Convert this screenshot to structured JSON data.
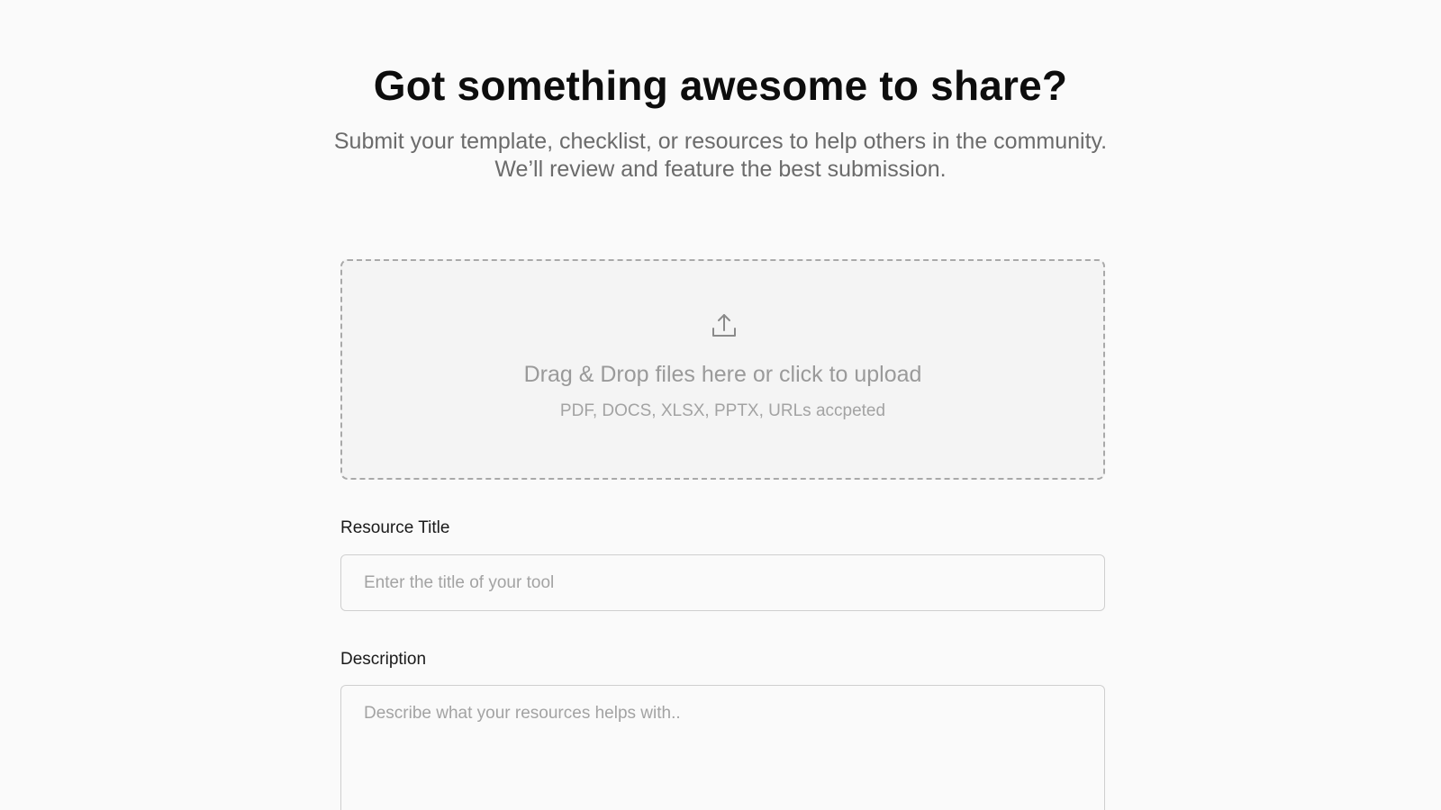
{
  "hero": {
    "title": "Got something awesome to share?",
    "subtitle_line1": "Submit your template, checklist, or resources to help others in the community.",
    "subtitle_line2": "We’ll review and feature the best submission."
  },
  "upload": {
    "icon": "upload-icon",
    "main_text": "Drag & Drop files here or click to upload",
    "sub_text": "PDF, DOCS, XLSX, PPTX, URLs accpeted"
  },
  "form": {
    "title_label": "Resource Title",
    "title_placeholder": "Enter the title of your tool",
    "title_value": "",
    "description_label": "Description",
    "description_placeholder": "Describe what your resources helps with..",
    "description_value": ""
  },
  "colors": {
    "background": "#fafafa",
    "heading": "#0d0d0d",
    "muted_text": "#6b6b6b",
    "placeholder": "#a3a3a3",
    "border": "#cfcfcf",
    "dashed_border": "#a9a9a9"
  }
}
